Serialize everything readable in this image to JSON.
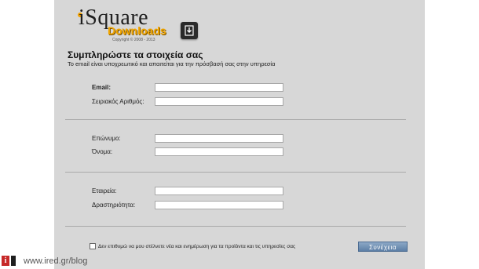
{
  "logo": {
    "word": "iSquare",
    "sub": "Downloads",
    "copyright": "Copyright © 2008 - 2013",
    "icon": "download-icon"
  },
  "form": {
    "title": "Συμπληρώστε τα στοιχεία σας",
    "subtitle": "Το email είναι υποχρεωτικό και απαιτείται για την πρόσβασή σας στην υπηρεσία",
    "fields": {
      "email": {
        "label": "Email:",
        "value": ""
      },
      "serial": {
        "label": "Σειριακός Αριθμός:",
        "value": ""
      },
      "lastname": {
        "label": "Επώνυμο:",
        "value": ""
      },
      "firstname": {
        "label": "Όνομα:",
        "value": ""
      },
      "company": {
        "label": "Εταιρεία:",
        "value": ""
      },
      "activity": {
        "label": "Δραστηριότητα:",
        "value": ""
      }
    },
    "consent": "Δεν επιθυμώ να μου στέλνετε νέα και ενημέρωση για τα προϊόντα και τις υπηρεσίες σας",
    "continue_label": "Συνέχεια"
  },
  "footer": {
    "logo_letter": "i",
    "url": "www.ired.gr/blog"
  }
}
